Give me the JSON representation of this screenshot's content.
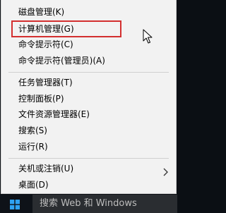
{
  "menu": {
    "items": [
      {
        "label": "磁盘管理(K)"
      },
      {
        "label": "计算机管理(G)"
      },
      {
        "label": "命令提示符(C)"
      },
      {
        "label": "命令提示符(管理员)(A)"
      },
      {
        "label": "任务管理器(T)"
      },
      {
        "label": "控制面板(P)"
      },
      {
        "label": "文件资源管理器(E)"
      },
      {
        "label": "搜索(S)"
      },
      {
        "label": "运行(R)"
      },
      {
        "label": "关机或注销(U)"
      },
      {
        "label": "桌面(D)"
      }
    ],
    "highlight_color": "#d32f2f"
  },
  "taskbar": {
    "search_text": "搜索 Web 和 Windows",
    "start_icon": "windows-logo-icon"
  }
}
